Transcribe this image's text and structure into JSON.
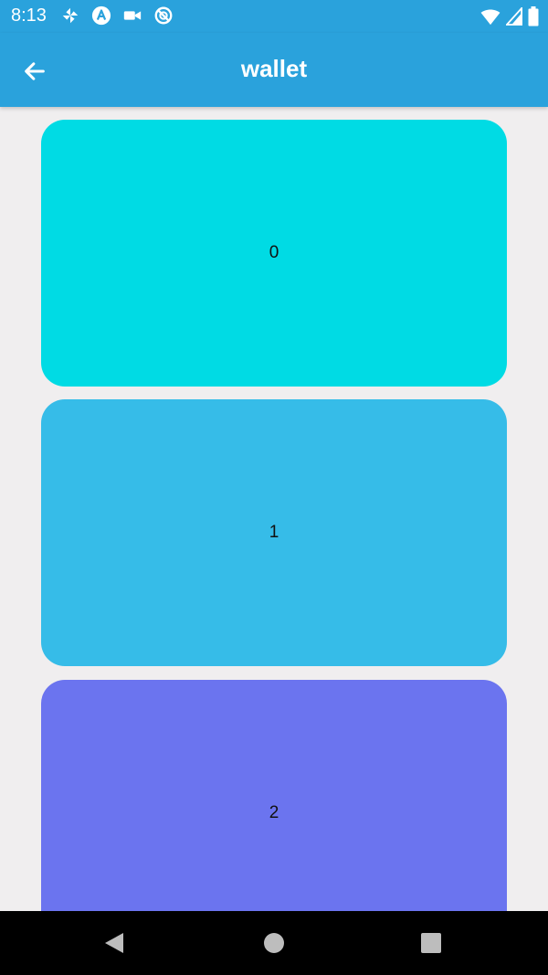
{
  "status_bar": {
    "time": "8:13",
    "left_icons": [
      "pinwheel-icon",
      "a-circle-icon",
      "video-camera-icon",
      "no-sync-icon"
    ],
    "right_icons": [
      "wifi-icon",
      "signal-icon",
      "battery-icon"
    ]
  },
  "app_bar": {
    "title": "wallet",
    "back_icon": "arrow-back-icon",
    "color": "#2aa2dc"
  },
  "cards": [
    {
      "label": "0",
      "color": "#00dbe4"
    },
    {
      "label": "1",
      "color": "#36bce8"
    },
    {
      "label": "2",
      "color": "#6b74ef"
    }
  ],
  "nav_bar": {
    "buttons": [
      "back-triangle-icon",
      "home-circle-icon",
      "recents-square-icon"
    ]
  }
}
